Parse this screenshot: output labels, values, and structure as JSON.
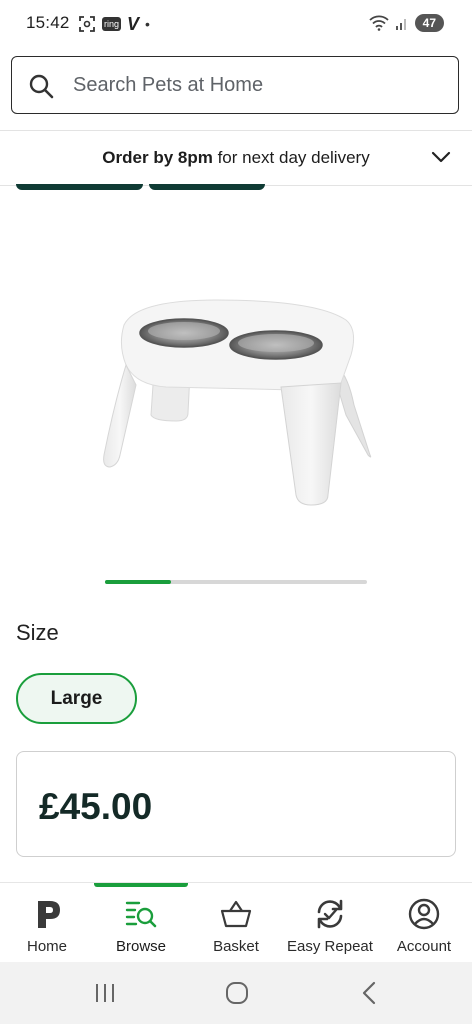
{
  "status_bar": {
    "time": "15:42",
    "notif_badge": "ring",
    "carrier_glyph": "V",
    "dot": "•",
    "battery": "47"
  },
  "search": {
    "placeholder": "Search Pets at Home"
  },
  "delivery": {
    "bold": "Order by 8pm",
    "rest": " for next day delivery"
  },
  "carousel": {
    "progress_fraction": 0.25
  },
  "size": {
    "label": "Size",
    "selected": "Large"
  },
  "price": {
    "value": "£45.00"
  },
  "bottom_nav": {
    "items": [
      {
        "label": "Home",
        "icon": "pets-at-home-logo-icon",
        "active": false
      },
      {
        "label": "Browse",
        "icon": "browse-search-icon",
        "active": true
      },
      {
        "label": "Basket",
        "icon": "basket-icon",
        "active": false
      },
      {
        "label": "Easy Repeat",
        "icon": "repeat-icon",
        "active": false
      },
      {
        "label": "Account",
        "icon": "account-icon",
        "active": false
      }
    ]
  },
  "colors": {
    "accent_green": "#1a9e3c",
    "dark_teal": "#0f3b34",
    "price_text": "#142a27"
  }
}
